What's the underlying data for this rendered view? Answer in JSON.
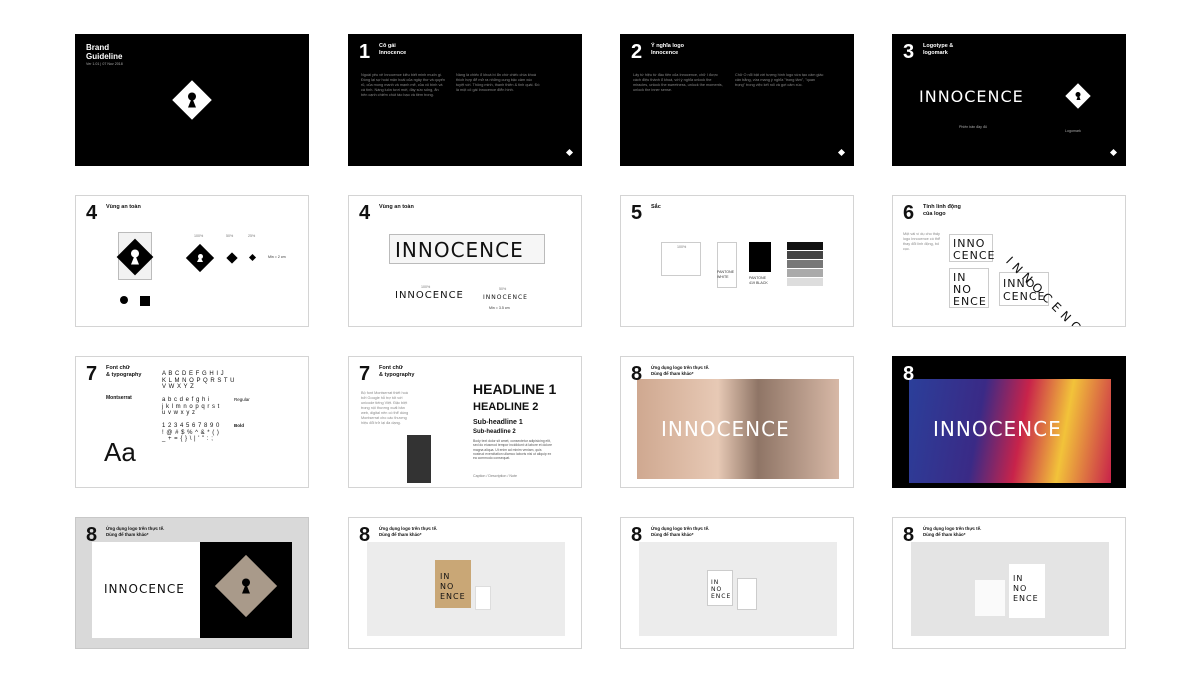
{
  "slides": {
    "s1": {
      "title_line1": "Brand",
      "title_line2": "Guideline",
      "version": "Ver 1.01 | 07 Nov 2018"
    },
    "s2": {
      "number": "1",
      "title": "Cô gái\nInnocence",
      "text_left": "Ngoài yêu vẻ Innocence kiêu biết minh muốn gì. Đồng lại sự hoài mận hoài của ngây thơ và quyến rũ, của mong manh và mạnh mẽ, của vô bình và cá tính. Nàng luôn tươi mới, đầy sức sống, ẩn bên cạnh chiếm chút táo bạo và tiềm trong.",
      "text_right": "Nàng là chiếc ổ khoá bí ẩn chờ chiếc chìa khoá thích hợp để mở ra những cung bậc cảm xúc tuyệt vời. Thông minh, thanh thiên & tinh quái. Đó là một cô gái Innocence điển hình."
    },
    "s3": {
      "number": "2",
      "title": "Ý nghĩa logo\nInnocence",
      "text_left": "Lấy tứ hiệu từ đầu tiên của Innocence, chữ I được cách điệu thành ổ khoá, với ý nghĩa unlock the miracles, unlock the sweetness, unlock the moments, unlock the inner sense.",
      "text_right": "Chữ O nổi bật với tượng hình logo vừa tạo cảm giác cân bằng, vừa mang ý nghĩa \"trong tâm\", \"quan trọng\" trong việc kết nối và gợi cảm xúc."
    },
    "s4": {
      "number": "3",
      "title": "Logotype &\nlogomark",
      "logotype": "INNOCENCE",
      "cap_left": "Phiên bản đầy đủ",
      "cap_right": "Logomark"
    },
    "s5": {
      "number": "4",
      "title": "Vùng an toàn",
      "pct": [
        "100%",
        "50%",
        "25%"
      ],
      "min": "Min = 2 cm"
    },
    "s6": {
      "number": "4",
      "title": "Vùng an toàn",
      "logotype": "INNOCENCE",
      "pct": [
        "100%",
        "50%"
      ],
      "min": "Min = 3.5 cm"
    },
    "s7": {
      "number": "5",
      "title": "Sắc",
      "sw_labels": [
        "100%",
        "PANTONE WHITE",
        "PANTONE 419 BLACK"
      ]
    },
    "s8": {
      "number": "6",
      "title": "Tính linh động\ncủa logo",
      "text": "Một vài ví dụ cho thấy logo Innocence có thể thay đổi linh động, bố cục.",
      "w1": [
        "INNO",
        "CENCE"
      ],
      "w2": [
        "IN",
        "NO",
        "ENCE"
      ],
      "w3": [
        "INNO",
        "CENCE"
      ],
      "diag": "INNOCENCE"
    },
    "s9": {
      "number": "7",
      "title": "Font chữ\n& typography",
      "font_name": "Montserrat",
      "alpha": "A B C D E F G H I J\nK L M N O P Q R S T U\nV W X Y Z\n\na b c d e f g h i\nj k l m n o p q r s t\nu v w x y z\n\n1 2 3 4 5 6 7 8 9 0\n! @ # $ % ^ & * ( )\n_ + = { } \\ | ' \" : ;",
      "aa": "Aa",
      "regular": "Regular",
      "bold": "Bold"
    },
    "s10": {
      "number": "7",
      "title": "Font chữ\n& typography",
      "text": "Bộ font Montserrat thiết hoá bởi Google hỗ trợ tốt với unicode tiếng Việt. Đặc biệt trong nội thương xuất bản web, digital nên có thể dùng Montserrat cho các thương hiệu đổi trở lại đa dạng.",
      "h1": "HEADLINE 1",
      "h2": "HEADLINE 2",
      "sh1": "Sub-headline 1",
      "sh2": "Sub-headline 2",
      "body": "Body text dolor sit amet, consectetur adipisicing elit, sed do eiusmod tempor incididunt ut labore et dolore magna aliqua. Ut enim ad minim veniam, quis nostrud exercitation ullamco laboris nisi ut aliquip ex ea commodo consequat.",
      "caption": "Caption / Description / Note"
    },
    "s11": {
      "number": "8",
      "title": "Ứng dụng logo trên thực tế.\nDùng để tham khảo*",
      "logotype": "INNOCENCE"
    },
    "s12": {
      "number": "8",
      "logotype": "INNOCENCE"
    },
    "s13": {
      "number": "8",
      "title": "Ứng dụng logo trên thực tế.\nDùng để tham khảo*",
      "logotype": "INNOCENCE"
    },
    "s14": {
      "number": "8",
      "title": "Ứng dụng logo trên thực tế.\nDùng để tham khảo*",
      "bag": [
        "IN",
        "NO",
        "ENCE"
      ]
    },
    "s15": {
      "number": "8",
      "title": "Ứng dụng logo trên thực tế.\nDùng để tham khảo*",
      "tag": [
        "IN",
        "NO",
        "ENCE"
      ]
    },
    "s16": {
      "number": "8",
      "title": "Ứng dụng logo trên thực tế.\nDùng để tham khảo*",
      "bag": [
        "IN",
        "NO",
        "ENCE"
      ]
    }
  },
  "colors": {
    "black": "#000000",
    "white": "#ffffff",
    "grey": "#d9d9d9",
    "photo_sky": "#e7c9b5",
    "flag_blue": "#2b3f9a",
    "flag_yellow": "#f2c33a",
    "flag_red": "#c8234a"
  },
  "icons": [
    "keyhole-diamond-icon"
  ]
}
